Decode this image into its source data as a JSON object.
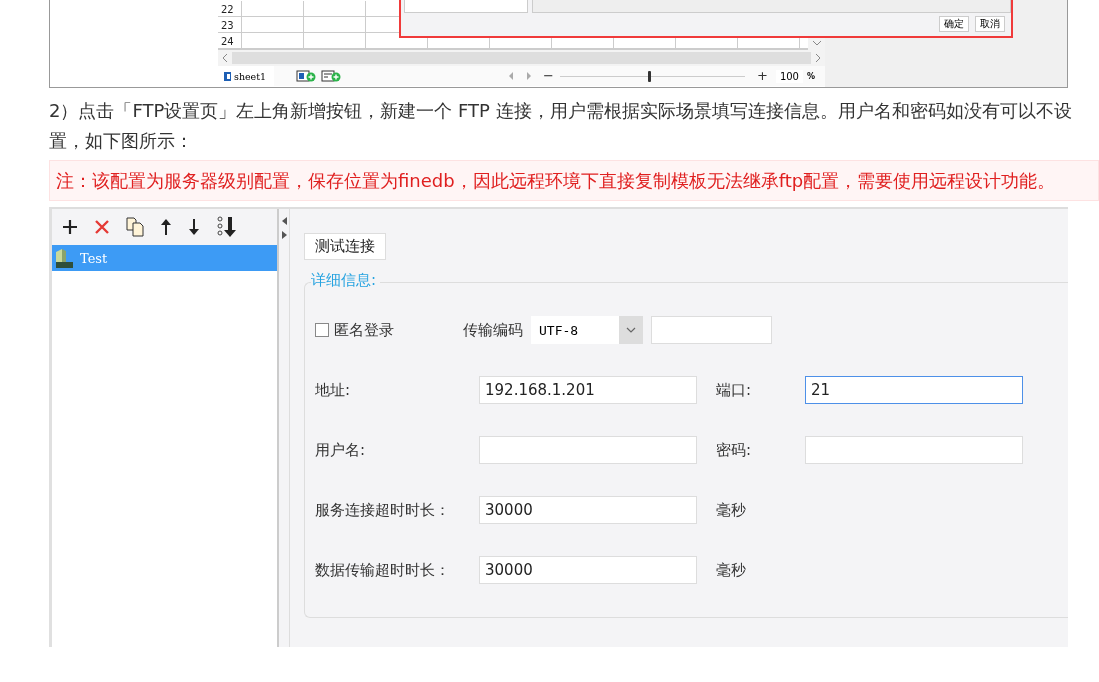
{
  "spreadsheet_screenshot": {
    "row_numbers": [
      "22",
      "23",
      "24"
    ],
    "dialog_buttons": [
      "确定",
      "取消"
    ],
    "sheet_tab": "sheet1",
    "zoom": {
      "minus": "−",
      "plus": "+",
      "level": 0.48,
      "value": "100",
      "unit": "%"
    }
  },
  "paragraph": "2）点击「FTP设置页」左上角新增按钮，新建一个 FTP 连接，用户需根据实际场景填写连接信息。用户名和密码如没有可以不设置，如下图所示：",
  "note": "注：该配置为服务器级别配置，保存位置为finedb，因此远程环境下直接复制模板无法继承ftp配置，需要使用远程设计功能。",
  "ftp_screenshot": {
    "connections": [
      {
        "name": "Test",
        "selected": true
      }
    ],
    "test_button": "测试连接",
    "section_title": "详细信息:",
    "anonymous": {
      "label": "匿名登录",
      "checked": false
    },
    "encoding": {
      "label": "传输编码",
      "value": "UTF-8"
    },
    "fields": [
      {
        "label": "地址:",
        "value": "192.168.1.201",
        "focused": false,
        "side_label": "端口:",
        "side_value": "21",
        "side_focused": true
      },
      {
        "label": "用户名:",
        "focused": false,
        "side_label": "密码:",
        "side_focused": false
      },
      {
        "label": "服务连接超时时长：",
        "value": "30000",
        "focused": false,
        "unit": "毫秒"
      },
      {
        "label": "数据传输超时时长：",
        "value": "30000",
        "focused": false,
        "unit": "毫秒"
      }
    ]
  }
}
